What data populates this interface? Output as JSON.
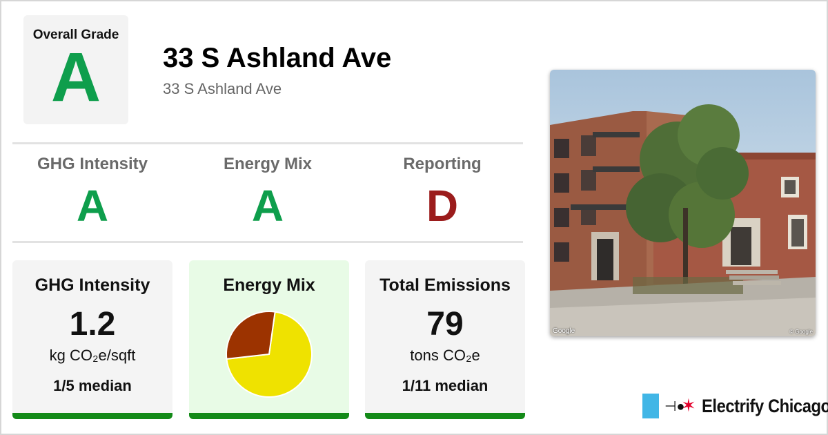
{
  "header": {
    "overall_label": "Overall Grade",
    "overall_grade": "A",
    "title": "33 S Ashland Ave",
    "address": "33 S Ashland Ave"
  },
  "grades": [
    {
      "label": "GHG Intensity",
      "grade": "A",
      "color": "#0e9e4c"
    },
    {
      "label": "Energy Mix",
      "grade": "A",
      "color": "#0e9e4c"
    },
    {
      "label": "Reporting",
      "grade": "D",
      "color": "#9b1c1c"
    }
  ],
  "cards": {
    "ghg": {
      "title": "GHG Intensity",
      "value": "1.2",
      "unit": "kg CO₂e/sqft",
      "median": "1/5 median",
      "bar_color": "#138a18",
      "bg": "#f4f4f4"
    },
    "mix": {
      "title": "Energy Mix",
      "bar_color": "#138a18",
      "bg": "#e8fbe6"
    },
    "total": {
      "title": "Total Emissions",
      "value": "79",
      "unit": "tons CO₂e",
      "median": "1/11 median",
      "bar_color": "#138a18",
      "bg": "#f4f4f4"
    }
  },
  "chart_data": {
    "type": "pie",
    "values": [
      71,
      29
    ],
    "colors": [
      "#efe200",
      "#9c3300"
    ]
  },
  "photo": {
    "credit_left": "Google",
    "credit_right": "© Google"
  },
  "brand": {
    "name": "Electrify Chicago",
    "flag_color": "#41b6e6",
    "star_color": "#e4002b"
  },
  "colors": {
    "grade_green": "#0e9e4c",
    "grade_red": "#9b1c1c"
  }
}
